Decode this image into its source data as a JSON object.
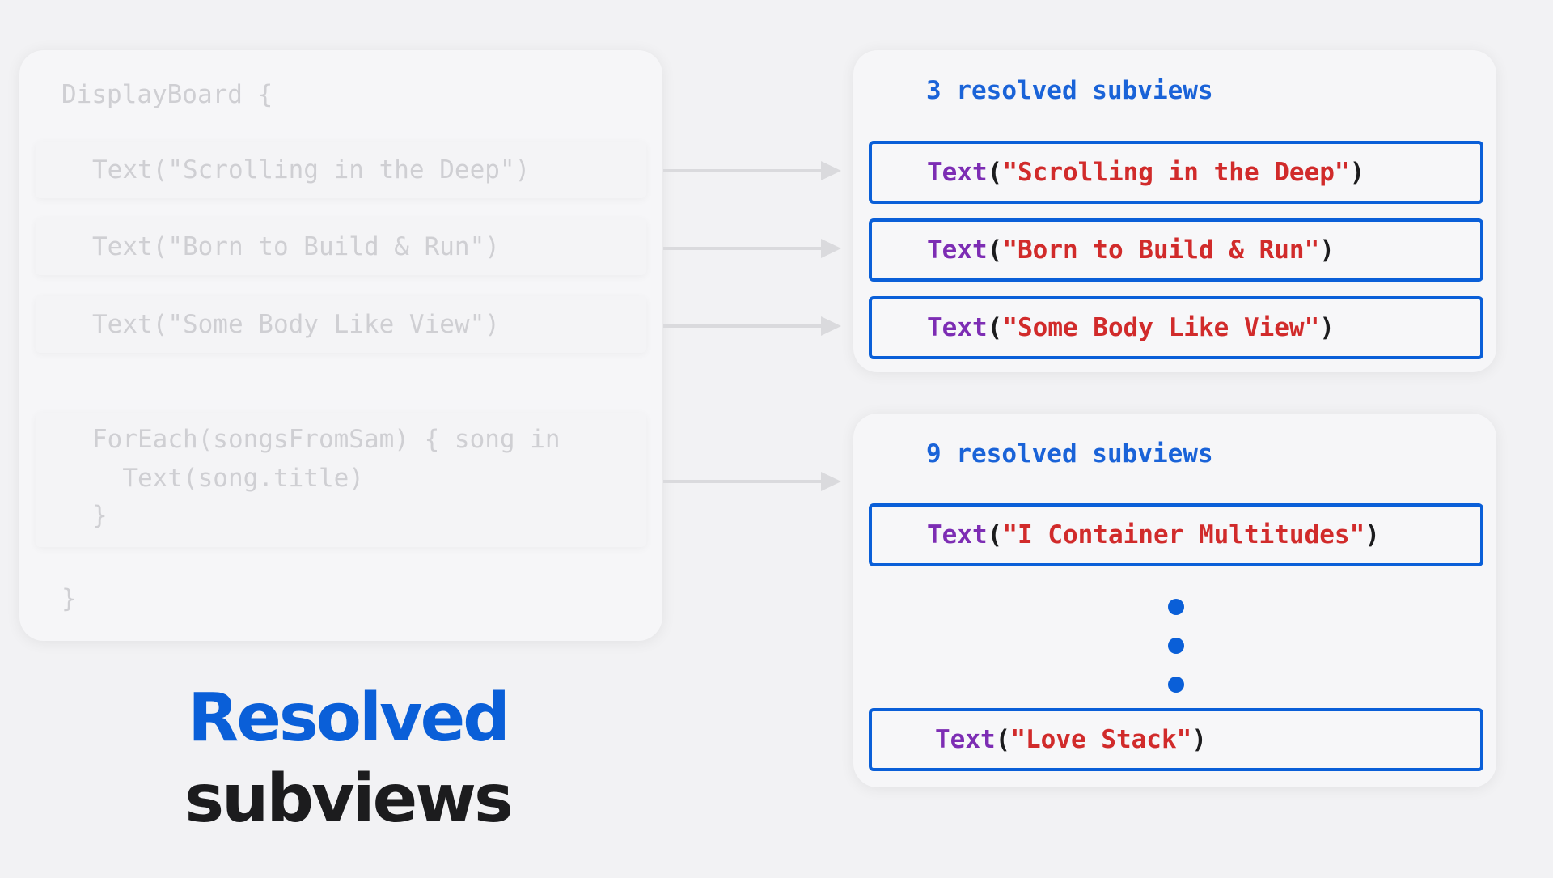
{
  "source": {
    "open_line": "DisplayBoard {",
    "lines": [
      "Text(\"Scrolling in the Deep\")",
      "Text(\"Born to Build & Run\")",
      "Text(\"Some Body Like View\")"
    ],
    "foreach_lines": [
      "ForEach(songsFromSam) { song in",
      "  Text(song.title)",
      "}"
    ],
    "close_line": "}"
  },
  "top_group": {
    "heading": "3 resolved subviews",
    "items": [
      {
        "kw": "Text",
        "open": "(",
        "str": "\"Scrolling in the Deep\"",
        "close": ")"
      },
      {
        "kw": "Text",
        "open": "(",
        "str": "\"Born to Build & Run\"",
        "close": ")"
      },
      {
        "kw": "Text",
        "open": "(",
        "str": "\"Some Body Like View\"",
        "close": ")"
      }
    ]
  },
  "bottom_group": {
    "heading": "9 resolved subviews",
    "items": [
      {
        "kw": "Text",
        "open": "(",
        "str": "\"I Container Multitudes\"",
        "close": ")"
      },
      {
        "kw": "Text",
        "open": "(",
        "str": "\"Love Stack\"",
        "close": ")"
      }
    ]
  },
  "title": {
    "line1": "Resolved",
    "line2": "subviews"
  },
  "colors": {
    "accent_blue": "#0a5fd8",
    "keyword_purple": "#7d2db4",
    "string_red": "#d12b2b",
    "faded_source": "#cfcfd3",
    "background": "#f2f2f4"
  }
}
